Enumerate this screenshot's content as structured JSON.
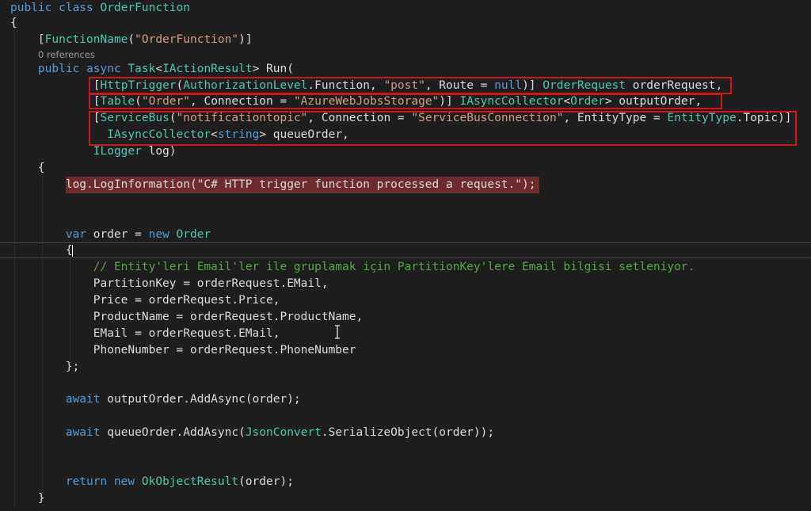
{
  "codelens": "0 references",
  "colors": {
    "background": "#1e1e1e",
    "keyword": "#569cd6",
    "type": "#4ec9b0",
    "string": "#d69d85",
    "comment": "#57a64a",
    "plain": "#dcdcdc",
    "highlight_border": "#d4141c",
    "highlight_fill": "#6e2b2c"
  },
  "lines": [
    {
      "tokens": [
        [
          "kw",
          "public "
        ],
        [
          "kw",
          "class "
        ],
        [
          "ty",
          "OrderFunction"
        ]
      ]
    },
    {
      "tokens": [
        [
          "pl",
          "{"
        ]
      ]
    },
    {
      "tokens": [
        [
          "pl",
          "    ["
        ],
        [
          "ty",
          "FunctionName"
        ],
        [
          "pl",
          "("
        ],
        [
          "str",
          "\"OrderFunction\""
        ],
        [
          "pl",
          ")]"
        ]
      ]
    },
    {
      "tokens": [
        [
          "pl",
          "    "
        ],
        [
          "kw",
          "public "
        ],
        [
          "kw",
          "async "
        ],
        [
          "ty",
          "Task"
        ],
        [
          "pl",
          "<"
        ],
        [
          "ty",
          "IActionResult"
        ],
        [
          "pl",
          "> Run("
        ]
      ]
    },
    {
      "tokens": [
        [
          "pl",
          "            ["
        ],
        [
          "ty",
          "HttpTrigger"
        ],
        [
          "pl",
          "("
        ],
        [
          "ty",
          "AuthorizationLevel"
        ],
        [
          "pl",
          ".Function, "
        ],
        [
          "str",
          "\"post\""
        ],
        [
          "pl",
          ", Route = "
        ],
        [
          "kw",
          "null"
        ],
        [
          "pl",
          ")] "
        ],
        [
          "ty",
          "OrderRequest"
        ],
        [
          "pl",
          " orderRequest,"
        ]
      ]
    },
    {
      "tokens": [
        [
          "pl",
          "            ["
        ],
        [
          "ty",
          "Table"
        ],
        [
          "pl",
          "("
        ],
        [
          "str",
          "\"Order\""
        ],
        [
          "pl",
          ", Connection = "
        ],
        [
          "str",
          "\"AzureWebJobsStorage\""
        ],
        [
          "pl",
          ")] "
        ],
        [
          "ty",
          "IAsyncCollector"
        ],
        [
          "pl",
          "<"
        ],
        [
          "ty",
          "Order"
        ],
        [
          "pl",
          "> outputOrder,"
        ]
      ]
    },
    {
      "tokens": [
        [
          "pl",
          "            ["
        ],
        [
          "ty",
          "ServiceBus"
        ],
        [
          "pl",
          "("
        ],
        [
          "str",
          "\"notificationtopic\""
        ],
        [
          "pl",
          ", Connection = "
        ],
        [
          "str",
          "\"ServiceBusConnection\""
        ],
        [
          "pl",
          ", EntityType = "
        ],
        [
          "ty",
          "EntityType"
        ],
        [
          "pl",
          ".Topic)]"
        ]
      ]
    },
    {
      "tokens": [
        [
          "pl",
          "              "
        ],
        [
          "ty",
          "IAsyncCollector"
        ],
        [
          "pl",
          "<"
        ],
        [
          "kw",
          "string"
        ],
        [
          "pl",
          "> queueOrder,"
        ]
      ]
    },
    {
      "tokens": [
        [
          "pl",
          "            "
        ],
        [
          "ty",
          "ILogger"
        ],
        [
          "pl",
          " log)"
        ]
      ]
    },
    {
      "tokens": [
        [
          "pl",
          "    {"
        ]
      ]
    },
    {
      "tokens": [
        [
          "pl",
          "        log.LogInformation("
        ],
        [
          "pl",
          "\"C# HTTP trigger function processed a request.\""
        ],
        [
          "pl",
          ");"
        ]
      ]
    },
    {
      "tokens": []
    },
    {
      "tokens": []
    },
    {
      "tokens": [
        [
          "pl",
          "        "
        ],
        [
          "kw",
          "var"
        ],
        [
          "pl",
          " order = "
        ],
        [
          "kw",
          "new "
        ],
        [
          "ty",
          "Order"
        ]
      ]
    },
    {
      "tokens": [
        [
          "pl",
          "        {"
        ]
      ]
    },
    {
      "tokens": [
        [
          "pl",
          "            "
        ],
        [
          "cm",
          "// Entity'leri Email'ler ile gruplamak için PartitionKey'lere Email bilgisi setleniyor."
        ]
      ]
    },
    {
      "tokens": [
        [
          "pl",
          "            PartitionKey = orderRequest.EMail,"
        ]
      ]
    },
    {
      "tokens": [
        [
          "pl",
          "            Price = orderRequest.Price,"
        ]
      ]
    },
    {
      "tokens": [
        [
          "pl",
          "            ProductName = orderRequest.ProductName,"
        ]
      ]
    },
    {
      "tokens": [
        [
          "pl",
          "            EMail = orderRequest.EMail,"
        ]
      ]
    },
    {
      "tokens": [
        [
          "pl",
          "            PhoneNumber = orderRequest.PhoneNumber"
        ]
      ]
    },
    {
      "tokens": [
        [
          "pl",
          "        };"
        ]
      ]
    },
    {
      "tokens": []
    },
    {
      "tokens": [
        [
          "pl",
          "        "
        ],
        [
          "kw",
          "await"
        ],
        [
          "pl",
          " outputOrder.AddAsync(order);"
        ]
      ]
    },
    {
      "tokens": []
    },
    {
      "tokens": [
        [
          "pl",
          "        "
        ],
        [
          "kw",
          "await"
        ],
        [
          "pl",
          " queueOrder.AddAsync("
        ],
        [
          "ty",
          "JsonConvert"
        ],
        [
          "pl",
          ".SerializeObject(order));"
        ]
      ]
    },
    {
      "tokens": []
    },
    {
      "tokens": []
    },
    {
      "tokens": [
        [
          "pl",
          "        "
        ],
        [
          "kw",
          "return "
        ],
        [
          "kw",
          "new "
        ],
        [
          "ty",
          "OkObjectResult"
        ],
        [
          "pl",
          "(order);"
        ]
      ]
    },
    {
      "tokens": [
        [
          "pl",
          "    }"
        ]
      ]
    }
  ]
}
